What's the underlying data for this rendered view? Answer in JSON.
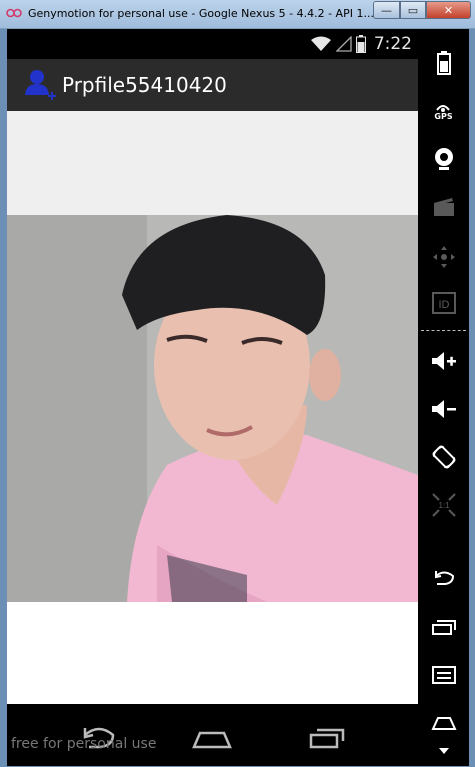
{
  "window": {
    "title": "Genymotion for personal use - Google Nexus 5 - 4.4.2 - API 1...",
    "minimize_label": "—",
    "maximize_label": "▭",
    "close_label": "✕"
  },
  "status_bar": {
    "time": "7:22",
    "icons": [
      "wifi-icon",
      "signal-icon",
      "battery-icon"
    ]
  },
  "action_bar": {
    "app_icon": "add-user-icon",
    "title": "Prpfile55410420"
  },
  "main": {
    "photo": "profile-photo"
  },
  "nav_bar": {
    "buttons": [
      "back-icon",
      "home-icon",
      "recent-apps-icon"
    ]
  },
  "watermark": "free for personal use",
  "toolbar": {
    "gps_label": "GPS",
    "id_label": "ID",
    "pixel_label": "1:1",
    "items": [
      "battery-icon",
      "gps-icon",
      "webcam-icon",
      "media-capture-icon",
      "dpad-icon",
      "device-id-icon",
      "volume-up-icon",
      "volume-down-icon",
      "rotate-icon",
      "pixel-perfect-icon",
      "back-icon",
      "recent-apps-icon",
      "menu-icon",
      "home-icon",
      "scroll-down-icon"
    ]
  },
  "colors": {
    "action_bar": "#2b2b2b",
    "accent_icon": "#2233cc",
    "gray_band": "#efefef",
    "shirt_pink": "#f2b8d2"
  }
}
